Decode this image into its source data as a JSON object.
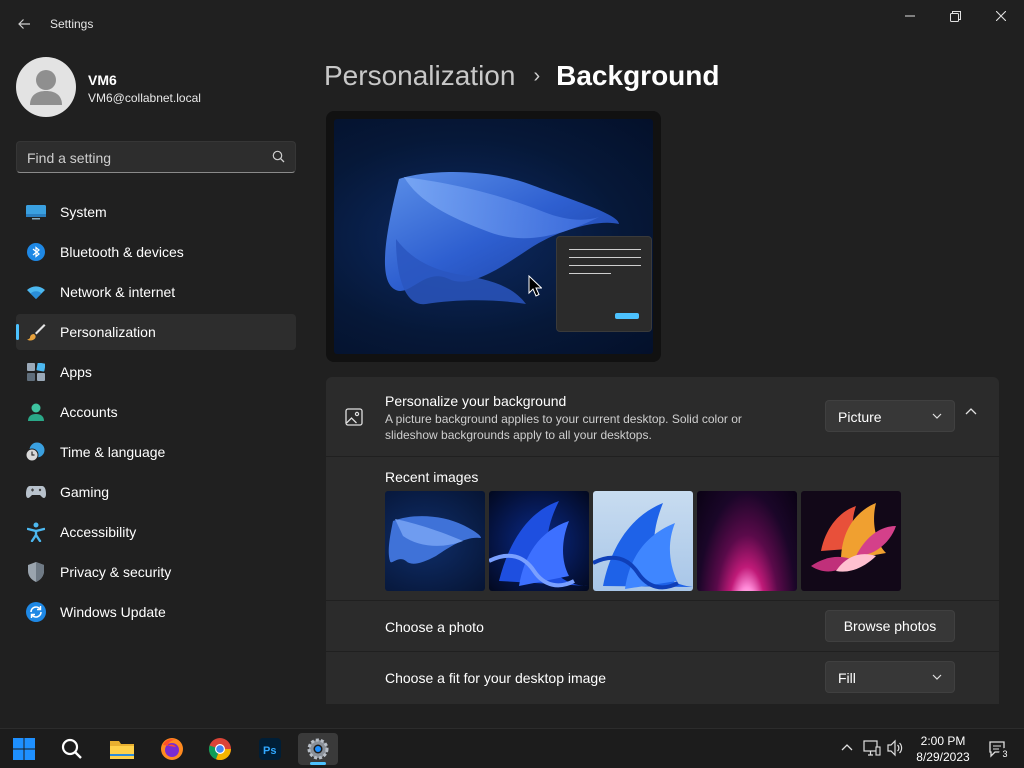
{
  "window": {
    "title": "Settings",
    "controls": [
      "minimize-icon",
      "restore-icon",
      "close-icon"
    ]
  },
  "user": {
    "name": "VM6",
    "email": "VM6@collabnet.local"
  },
  "search": {
    "placeholder": "Find a setting"
  },
  "sidebar": {
    "items": [
      {
        "label": "System",
        "icon": "system-icon"
      },
      {
        "label": "Bluetooth & devices",
        "icon": "bluetooth-icon"
      },
      {
        "label": "Network & internet",
        "icon": "wifi-icon"
      },
      {
        "label": "Personalization",
        "icon": "brush-icon",
        "active": true
      },
      {
        "label": "Apps",
        "icon": "apps-icon"
      },
      {
        "label": "Accounts",
        "icon": "accounts-icon"
      },
      {
        "label": "Time & language",
        "icon": "clock-globe-icon"
      },
      {
        "label": "Gaming",
        "icon": "gamepad-icon"
      },
      {
        "label": "Accessibility",
        "icon": "accessibility-icon"
      },
      {
        "label": "Privacy & security",
        "icon": "shield-icon"
      },
      {
        "label": "Windows Update",
        "icon": "update-icon"
      }
    ]
  },
  "breadcrumb": {
    "parent": "Personalization",
    "separator": "›",
    "current": "Background"
  },
  "background": {
    "title": "Personalize your background",
    "description": "A picture background applies to your current desktop. Solid color or slideshow backgrounds apply to all your desktops.",
    "type_value": "Picture",
    "recent_label": "Recent images",
    "recent_images": [
      "bloom-blue-flat",
      "bloom-blue-dark",
      "bloom-blue-light",
      "glow-purple",
      "bloom-colorful"
    ],
    "choose_photo_label": "Choose a photo",
    "browse_label": "Browse photos",
    "fit_label": "Choose a fit for your desktop image",
    "fit_value": "Fill"
  },
  "taskbar": {
    "apps": [
      "start-icon",
      "search-icon",
      "file-explorer-icon",
      "firefox-icon",
      "chrome-icon",
      "photoshop-icon",
      "settings-icon"
    ],
    "time": "2:00 PM",
    "date": "8/29/2023",
    "notifications": "3"
  },
  "colors": {
    "accent": "#4cc2ff",
    "background": "#202020",
    "card": "#2b2b2b"
  }
}
